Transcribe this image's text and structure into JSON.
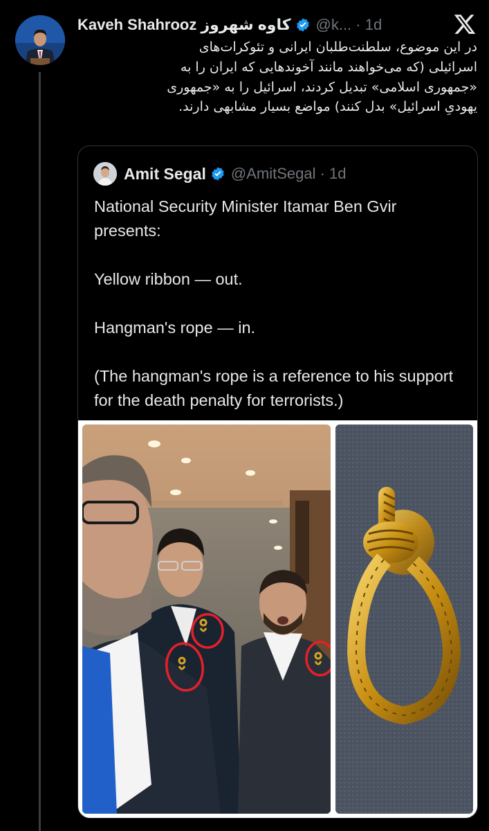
{
  "tweet": {
    "author_name": "Kaveh Shahrooz کاوه شهروز",
    "handle_time": "@k... · 1d",
    "verified_icon": "verified-badge-icon",
    "text_lines": [
      "در این موضوع، سلطنت‌طلبان ایرانی و تئوکرات‌های",
      "اسرائیلی (که می‌خواهند مانند آخوندهایی که ایران را به",
      "«جمهوری اسلامی» تبدیل کردند، اسرائیل را به «جمهوری",
      "یهودیِ اسرائیل» بدل کنند) مواضع بسیار مشابهی دارند."
    ]
  },
  "quoted": {
    "author_name": "Amit Segal",
    "handle_time": "@AmitSegal · 1d",
    "paragraphs": [
      "National Security Minister Itamar Ben Gvir presents:",
      "Yellow ribbon — out.",
      "Hangman's rope — in.",
      "(The hangman's rope is a reference to his support for the death penalty for terrorists.)"
    ]
  },
  "media": {
    "photo_left": "three-men-with-circled-noose-pins-photo",
    "photo_right": "gold-noose-pin-closeup-photo"
  },
  "colors": {
    "background": "#000000",
    "text": "#e7e9ea",
    "secondary": "#71767b",
    "verified": "#1d9bf0",
    "border": "#2f3336",
    "annotation_red": "#e5202a",
    "gold": "#d9a520"
  },
  "icons": [
    "x-logo-icon",
    "verified-badge-icon"
  ]
}
